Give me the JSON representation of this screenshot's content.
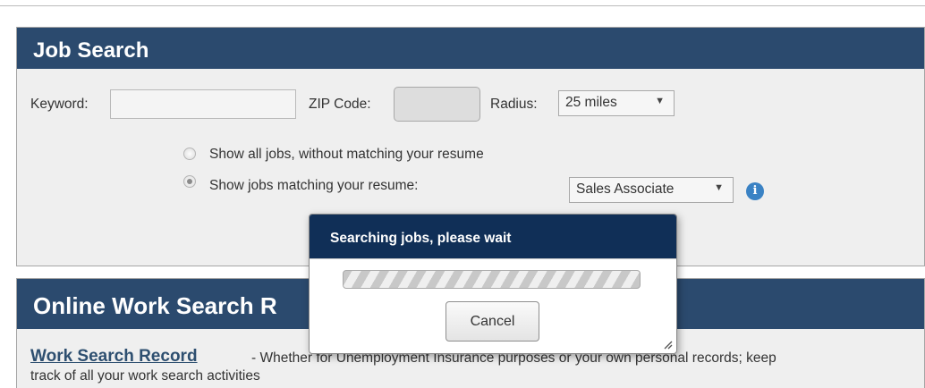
{
  "job_search": {
    "title": "Job Search",
    "keyword_label": "Keyword:",
    "keyword_value": "",
    "zip_label": "ZIP Code:",
    "zip_value": "",
    "radius_label": "Radius:",
    "radius_value": "25 miles",
    "radio_all_label": "Show all jobs, without matching your resume",
    "radio_match_label": "Show jobs matching your resume:",
    "selected_radio": "match",
    "resume_select_value": "Sales Associate",
    "info_icon": "info-icon"
  },
  "work_search": {
    "title": "Online Work Search R",
    "record_link": "Work Search Record",
    "record_desc": " - Whether for Unemployment Insurance purposes or your own personal records; keep",
    "record_desc2": "track of all your work search activities"
  },
  "modal": {
    "title": "Searching jobs, please wait",
    "cancel_label": "Cancel"
  },
  "colors": {
    "panel_header": "#2b4a6e",
    "modal_header": "#102f57",
    "info_icon": "#3a82c4",
    "link": "#2e4f70"
  }
}
